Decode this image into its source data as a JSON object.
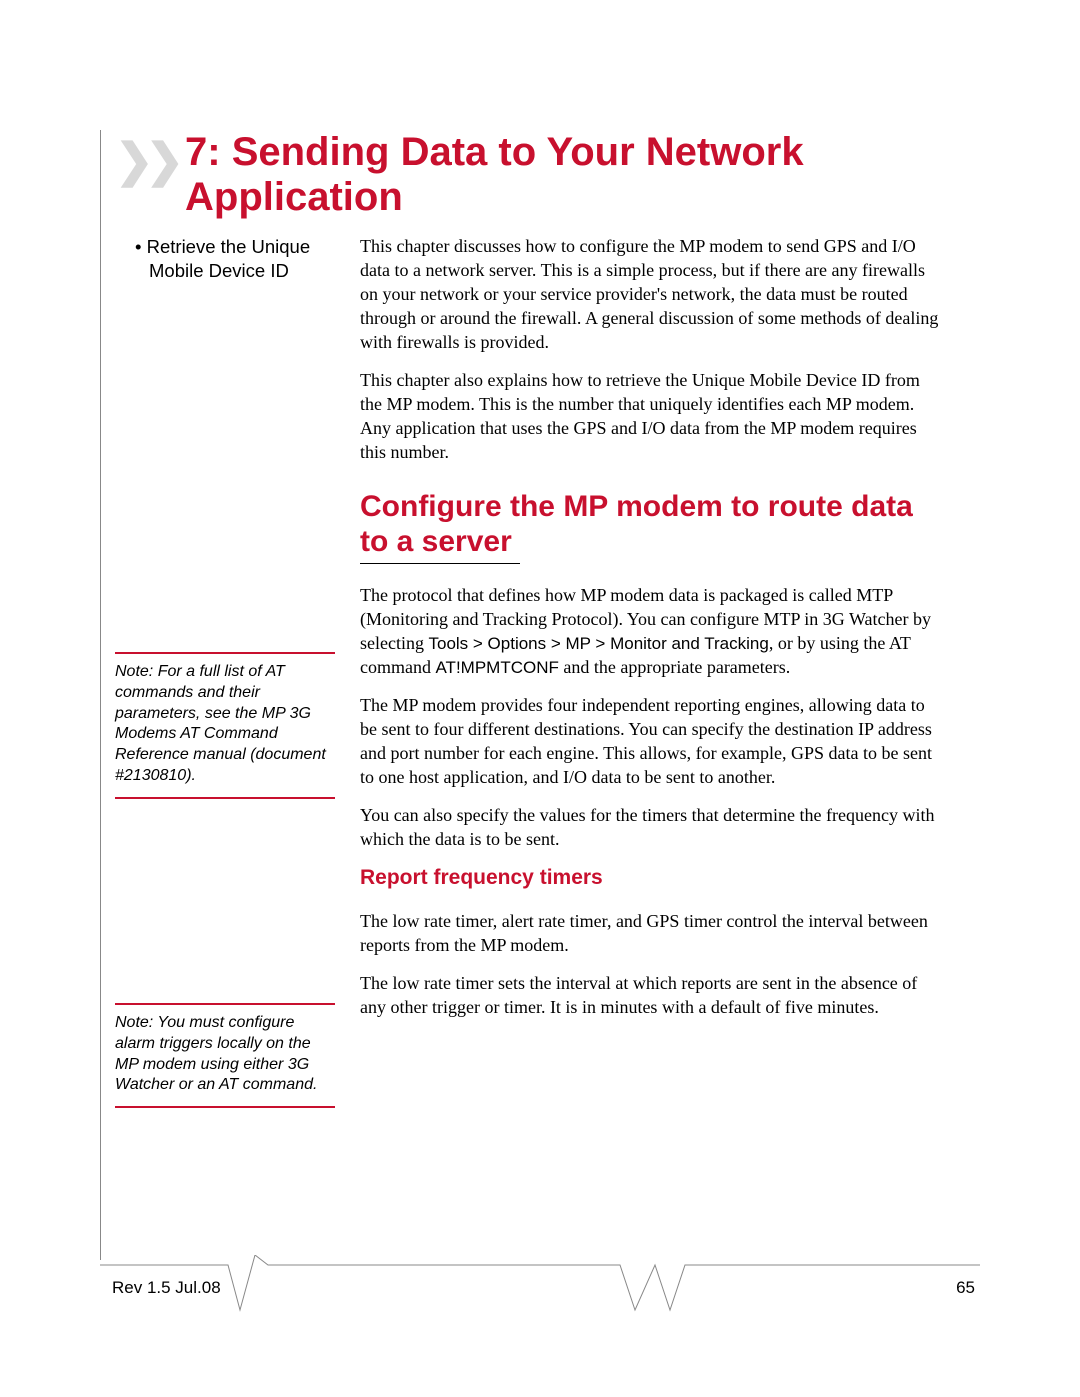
{
  "chapter": {
    "number": "7",
    "title": "Sending Data to Your Network Application"
  },
  "toc": {
    "item1": "Retrieve the Unique Mobile Device ID"
  },
  "intro": {
    "p1": "This chapter discusses how to configure the MP modem to send GPS and I/O data to a network server. This is a simple process, but if there are any firewalls on your network or your service provider's network, the data must be routed through or around the firewall. A general discussion of some methods of dealing with firewalls is provided.",
    "p2": "This chapter also explains how to retrieve the Unique Mobile Device ID from the MP modem. This is the number that uniquely identifies each MP modem. Any application that uses the GPS and I/O data from the MP modem requires this number."
  },
  "sections": {
    "configure": {
      "heading": "Configure the MP modem to route data to a server",
      "p1a": "The protocol that defines how MP modem data is packaged is called MTP (Monitoring and Tracking Protocol). You can configure MTP in 3G Watcher by selecting ",
      "p1b": "Tools > Options > MP > Monitor and Tracking",
      "p1c": ", or by using the AT command ",
      "p1d": "AT!MPMTCONF",
      "p1e": " and the appropriate parameters.",
      "p2": "The MP modem provides four independent reporting engines, allowing data to be sent to four different destinations. You can specify the destination IP address and port number for each engine. This allows, for example, GPS data to be sent to one host application, and I/O data to be sent to another.",
      "p3": "You can also specify the values for the timers that determine the frequency with which the data is to be sent."
    },
    "timers": {
      "heading": "Report frequency timers",
      "p1": "The low rate timer, alert rate timer, and GPS timer control the interval between reports from the MP modem.",
      "p2": "The low rate timer sets the interval at which reports are sent in the absence of any other trigger or timer. It is in minutes with a default of five minutes."
    }
  },
  "notes": {
    "n1": "Note: For a full list of AT commands and their parameters, see the MP 3G Modems AT Command Reference manual (document #2130810).",
    "n2": "Note: You must configure alarm triggers locally on the MP modem using either 3G Watcher or an AT command."
  },
  "footer": {
    "rev": "Rev 1.5  Jul.08",
    "page": "65"
  }
}
